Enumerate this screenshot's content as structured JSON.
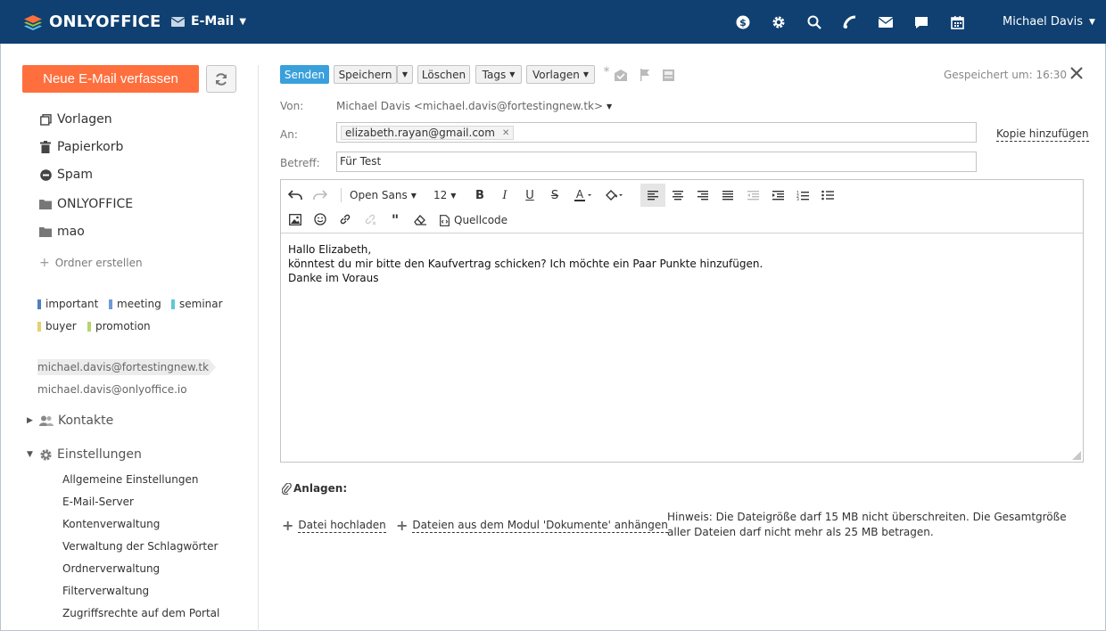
{
  "header": {
    "brand": "ONLYOFFICE",
    "module": "E-Mail",
    "user": "Michael Davis",
    "icons": [
      "payments-icon",
      "settings-icon",
      "search-icon",
      "feed-icon",
      "mail-icon",
      "chat-icon",
      "calendar-icon"
    ]
  },
  "sidebar": {
    "compose_label": "Neue E-Mail verfassen",
    "folders": [
      {
        "label": "Vorlagen",
        "icon": "templates-icon"
      },
      {
        "label": "Papierkorb",
        "icon": "trash-icon"
      },
      {
        "label": "Spam",
        "icon": "spam-icon"
      },
      {
        "label": "ONLYOFFICE",
        "icon": "folder-icon"
      },
      {
        "label": "mao",
        "icon": "folder-icon"
      }
    ],
    "create_folder": "Ordner erstellen",
    "tags": [
      {
        "label": "important",
        "color": "#4f7fba"
      },
      {
        "label": "meeting",
        "color": "#6f9ad6"
      },
      {
        "label": "seminar",
        "color": "#5ec8d3"
      },
      {
        "label": "buyer",
        "color": "#e4d36b"
      },
      {
        "label": "promotion",
        "color": "#b5d46d"
      }
    ],
    "accounts": [
      "michael.davis@fortestingnew.tk",
      "michael.davis@onlyoffice.io"
    ],
    "contacts": "Kontakte",
    "settings": "Einstellungen",
    "settings_items": [
      "Allgemeine Einstellungen",
      "E-Mail-Server",
      "Kontenverwaltung",
      "Verwaltung der Schlagwörter",
      "Ordnerverwaltung",
      "Filterverwaltung",
      "Zugriffsrechte auf dem Portal"
    ]
  },
  "compose": {
    "toolbar": {
      "send": "Senden",
      "save": "Speichern",
      "delete": "Löschen",
      "tags": "Tags",
      "templates": "Vorlagen",
      "saved_at": "Gespeichert um: 16:30"
    },
    "from_label": "Von:",
    "from_value": "Michael Davis <michael.davis@fortestingnew.tk>",
    "to_label": "An:",
    "to_value": "elizabeth.rayan@gmail.com",
    "add_copy": "Kopie hinzufügen",
    "subject_label": "Betreff:",
    "subject_value": "Für Test",
    "editor": {
      "font": "Open Sans",
      "size": "12",
      "source": "Quellcode",
      "body": [
        "Hallo Elizabeth,",
        "könntest du mir bitte den Kaufvertrag schicken? Ich möchte ein Paar Punkte hinzufügen.",
        "Danke im Voraus"
      ]
    },
    "attachments": {
      "title": "Anlagen:",
      "upload": "Datei hochladen",
      "from_docs": "Dateien aus dem Modul 'Dokumente' anhängen",
      "hint": "Hinweis: Die Dateigröße darf 15 MB nicht überschreiten. Die Gesamtgröße aller Dateien darf nicht mehr als 25 MB betragen."
    }
  }
}
